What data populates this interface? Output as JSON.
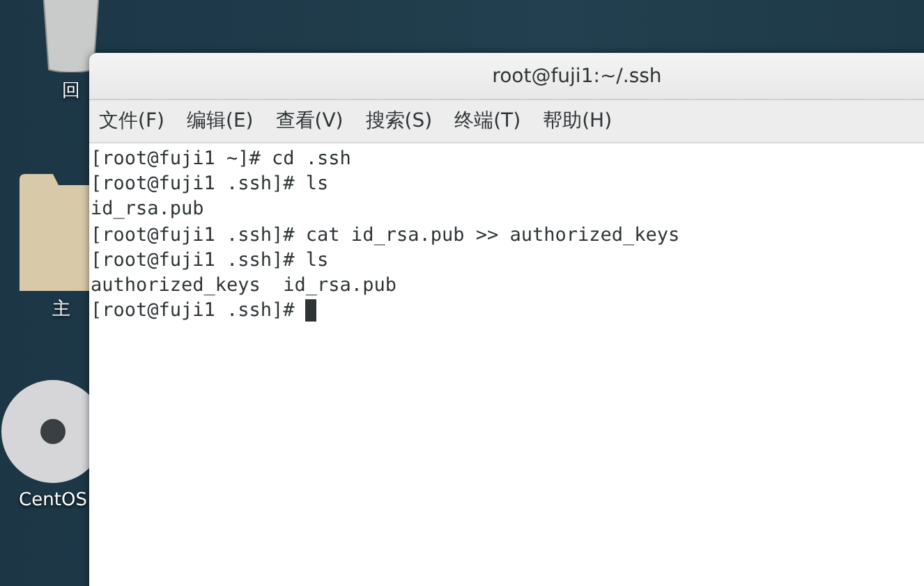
{
  "desktop": {
    "icons": [
      {
        "kind": "trash",
        "label": "回"
      },
      {
        "kind": "folder",
        "label": "主"
      },
      {
        "kind": "disc",
        "label": "CentOS"
      }
    ]
  },
  "window": {
    "title": "root@fuji1:~/.ssh",
    "menu": [
      "文件(F)",
      "编辑(E)",
      "查看(V)",
      "搜索(S)",
      "终端(T)",
      "帮助(H)"
    ],
    "terminal": {
      "lines": [
        "[root@fuji1 ~]# cd .ssh",
        "[root@fuji1 .ssh]# ls",
        "id_rsa.pub",
        "[root@fuji1 .ssh]# cat id_rsa.pub >> authorized_keys",
        "[root@fuji1 .ssh]# ls",
        "authorized_keys  id_rsa.pub",
        "[root@fuji1 .ssh]# "
      ]
    }
  }
}
